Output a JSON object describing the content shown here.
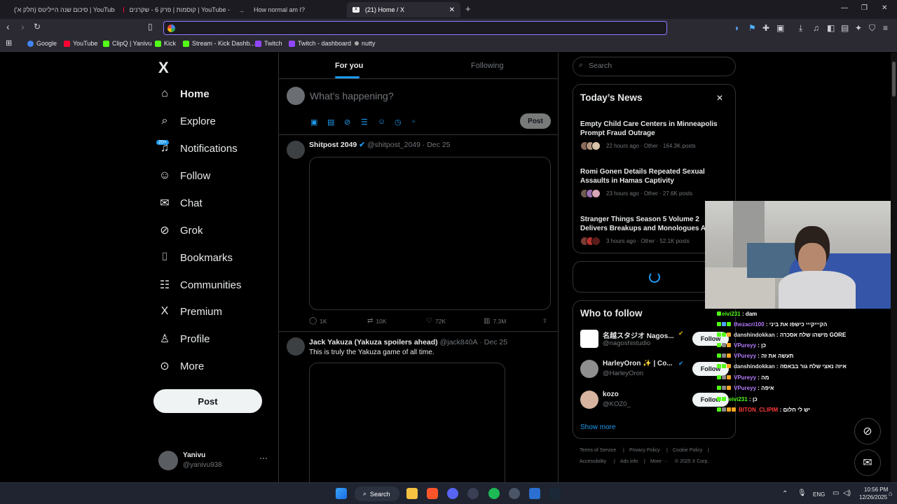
{
  "browser": {
    "tabs": [
      {
        "label": "סיכום שנה הייליטס (חלק א') | YouTube",
        "color": "#ff0033"
      },
      {
        "label": "קוסמות | פרק 6 - שקרנים | YouTube -",
        "color": "#ff0033"
      },
      {
        "label": "How normal am I?",
        "color": "#888888"
      },
      {
        "label": "(21) Home / X",
        "color": "#ffffff"
      }
    ],
    "new_tab": "+",
    "url_value": "",
    "bookmarks": [
      {
        "label": "Google",
        "color": "#4285f4"
      },
      {
        "label": "YouTube",
        "color": "#ff0033"
      },
      {
        "label": "ClipQ | Yanivu",
        "color": "#53fc18"
      },
      {
        "label": "Kick",
        "color": "#53fc18"
      },
      {
        "label": "Stream - Kick Dashb...",
        "color": "#53fc18"
      },
      {
        "label": "Twitch",
        "color": "#9146ff"
      },
      {
        "label": "Twitch - dashboard",
        "color": "#9146ff"
      },
      {
        "label": "nutty",
        "color": "#aaaaaa"
      }
    ]
  },
  "sidebar": {
    "logo": "X",
    "badge": "20+",
    "items": [
      {
        "label": "Home",
        "icon": "home-icon",
        "glyph": "⌂"
      },
      {
        "label": "Explore",
        "icon": "search-icon",
        "glyph": "⌕"
      },
      {
        "label": "Notifications",
        "icon": "bell-icon",
        "glyph": "🔔"
      },
      {
        "label": "Follow",
        "icon": "follow-icon",
        "glyph": "👤"
      },
      {
        "label": "Chat",
        "icon": "mail-icon",
        "glyph": "✉"
      },
      {
        "label": "Grok",
        "icon": "grok-icon",
        "glyph": "⊘"
      },
      {
        "label": "Bookmarks",
        "icon": "bookmark-icon",
        "glyph": "🔖"
      },
      {
        "label": "Communities",
        "icon": "communities-icon",
        "glyph": "👥"
      },
      {
        "label": "Premium",
        "icon": "x-premium-icon",
        "glyph": "𝕏"
      },
      {
        "label": "Profile",
        "icon": "profile-icon",
        "glyph": "👤"
      },
      {
        "label": "More",
        "icon": "more-icon",
        "glyph": "⋯"
      }
    ],
    "post_label": "Post",
    "account": {
      "name": "Yanivu",
      "handle": "@yanivu938",
      "menu": "···"
    }
  },
  "timeline": {
    "tabs": [
      "For you",
      "Following"
    ],
    "composer_placeholder": "What’s happening?",
    "composer_post": "Post",
    "tweets": [
      {
        "name": "Shitpost 2049",
        "handle": "@shitpost_2049",
        "date": "· Dec 25",
        "text": "",
        "replies": "1K",
        "reposts": "10K",
        "likes": "72K",
        "views": "7.3M"
      },
      {
        "name": "Jack Yakuza (Yakuza spoilers ahead)",
        "handle": "@jack840A",
        "date": "· Dec 25",
        "text": "This is truly the Yakuza game of all time."
      }
    ]
  },
  "right": {
    "search_placeholder": "Search",
    "news_title": "Today’s News",
    "news": [
      {
        "line1": "Empty Child Care Centers in Minneapolis",
        "line2": "Prompt Fraud Outrage",
        "meta": "22 hours ago · Other · 164.3K posts"
      },
      {
        "line1": "Romi Gonen Details Repeated Sexual",
        "line2": "Assaults in Hamas Captivity",
        "meta": "23 hours ago · Other · 27.6K posts"
      },
      {
        "line1": "Stranger Things Season 5 Volume 2",
        "line2": "Delivers Breakups and Monologues A",
        "meta": "3 hours ago · Other · 52.1K posts"
      }
    ],
    "wtf_title": "Who to follow",
    "wtf": [
      {
        "name": "名越スタジオ Nagos...",
        "handle": "@nagoshistudio",
        "follow": "Follow"
      },
      {
        "name": "HarleyOron ✨ | Co...",
        "handle": "@HarleyOron",
        "follow": "Follow"
      },
      {
        "name": "kozo",
        "handle": "@KOZ0_",
        "follow": "Follow"
      }
    ],
    "show_more": "Show more",
    "footer": [
      "Terms of Service",
      "|",
      "Privacy Policy",
      "|",
      "Cookie Policy",
      "|",
      "Accessibility",
      "|",
      "Ads info",
      "|",
      "More ···",
      "© 2025 X Corp."
    ]
  },
  "chat": [
    {
      "nick": "eivi231",
      "msg": ": dam",
      "color": "#53fc18"
    },
    {
      "nick": "thezacri100",
      "msg": ": הקיייקייי כישפו את ביני",
      "color": "#b67cff"
    },
    {
      "nick": "danshindokkan",
      "msg": ": מישהו שלח אסכרה GORE",
      "color": "#e0e0e0"
    },
    {
      "nick": "VPureyy",
      "msg": ": כן",
      "color": "#b67cff"
    },
    {
      "nick": "VPureyy",
      "msg": ": תעשה את זה",
      "color": "#b67cff"
    },
    {
      "nick": "danshindokkan",
      "msg": ": איזה נאצי שלח גור בבאסה",
      "color": "#e0e0e0"
    },
    {
      "nick": "VPureyy",
      "msg": ": מה",
      "color": "#b67cff"
    },
    {
      "nick": "VPureyy",
      "msg": ": איפה",
      "color": "#b67cff"
    },
    {
      "nick": "eivi231",
      "msg": ": כן",
      "color": "#53fc18"
    },
    {
      "nick": "BITON_CLIPIM",
      "msg": ": יש לי חלום",
      "color": "#ff3b3b"
    }
  ],
  "taskbar": {
    "search_label": "Search",
    "lang": "ENG",
    "time": "10:56 PM",
    "date": "12/26/2025"
  }
}
